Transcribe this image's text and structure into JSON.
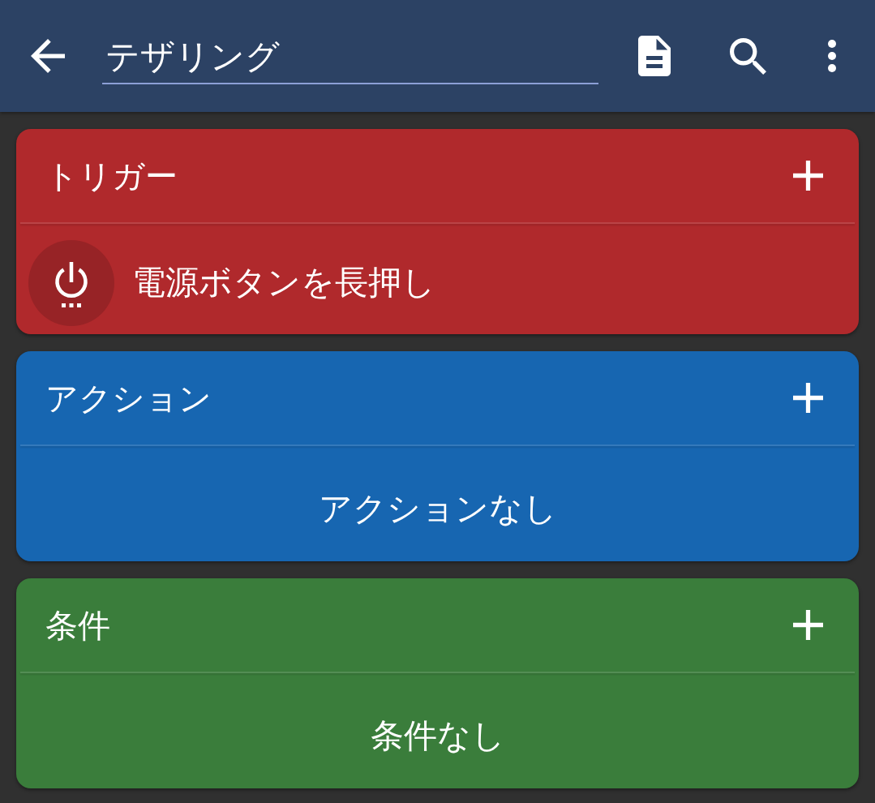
{
  "toolbar": {
    "title_field": {
      "value": "テザリング"
    }
  },
  "sections": [
    {
      "title": "トリガー",
      "color": "#b0292c",
      "items": [
        {
          "label": "電源ボタンを長押し"
        }
      ]
    },
    {
      "title": "アクション",
      "color": "#1766b1",
      "empty_text": "アクションなし"
    },
    {
      "title": "条件",
      "color": "#3a7d3b",
      "empty_text": "条件なし"
    }
  ]
}
